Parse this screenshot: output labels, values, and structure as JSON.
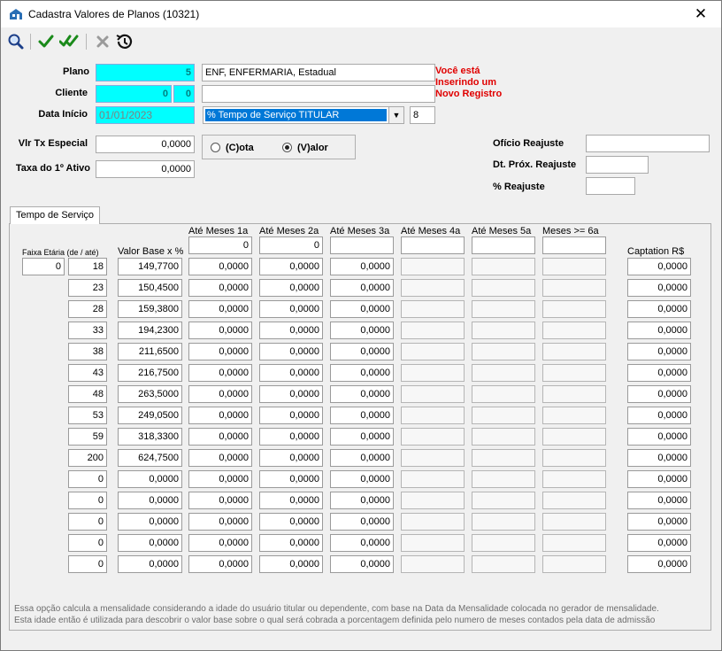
{
  "window": {
    "title": "Cadastra Valores de Planos (10321)",
    "close_glyph": "✕"
  },
  "toolbar": {
    "icons": [
      "search-icon",
      "check-icon",
      "double-check-icon",
      "cancel-x-icon",
      "history-icon"
    ],
    "accent_check": "#1a8a1a"
  },
  "form": {
    "plano": {
      "label": "Plano",
      "code": "5",
      "description": "ENF, ENFERMARIA, Estadual"
    },
    "cliente": {
      "label": "Cliente",
      "code1": "0",
      "code2": "0",
      "description": ""
    },
    "data_inicio": {
      "label": "Data Início",
      "value": "01/01/2023"
    },
    "tipo": {
      "selected": "% Tempo de Serviço TITULAR",
      "extra": "8"
    },
    "warning": {
      "line1": "Você está",
      "line2": "Inserindo um",
      "line3": "Novo Registro",
      "color": "#e00000"
    },
    "vlr_tx_especial": {
      "label": "Vlr Tx Especial",
      "value": "0,0000"
    },
    "taxa_primeiro_ativo": {
      "label": "Taxa do 1º Ativo",
      "value": "0,0000"
    },
    "radio": {
      "cota_label": "(C)ota",
      "valor_label": "(V)alor",
      "selected": "valor"
    },
    "oficio_reajuste": {
      "label": "Ofício Reajuste",
      "value": ""
    },
    "dt_prox_reajuste": {
      "label": "Dt. Próx. Reajuste",
      "value": ""
    },
    "pct_reajuste": {
      "label": "% Reajuste",
      "value": ""
    }
  },
  "tab": {
    "label": "Tempo de Serviço"
  },
  "grid": {
    "headers": {
      "faixa": "Faixa Etária (de / até)",
      "valor_base": "Valor Base x %",
      "m1": "Até Meses 1a",
      "m2": "Até Meses 2a",
      "m3": "Até Meses 3a",
      "m4": "Até Meses 4a",
      "m5": "Até Meses 5a",
      "m6": "Meses >= 6a",
      "captation": "Captation R$"
    },
    "meses_limits": [
      "0",
      "0",
      "",
      "",
      "",
      ""
    ],
    "faixa_de_first": "0",
    "rows": [
      {
        "ate": "18",
        "base": "149,7700",
        "m1": "0,0000",
        "m2": "0,0000",
        "m3": "0,0000",
        "captation": "0,0000"
      },
      {
        "ate": "23",
        "base": "150,4500",
        "m1": "0,0000",
        "m2": "0,0000",
        "m3": "0,0000",
        "captation": "0,0000"
      },
      {
        "ate": "28",
        "base": "159,3800",
        "m1": "0,0000",
        "m2": "0,0000",
        "m3": "0,0000",
        "captation": "0,0000"
      },
      {
        "ate": "33",
        "base": "194,2300",
        "m1": "0,0000",
        "m2": "0,0000",
        "m3": "0,0000",
        "captation": "0,0000"
      },
      {
        "ate": "38",
        "base": "211,6500",
        "m1": "0,0000",
        "m2": "0,0000",
        "m3": "0,0000",
        "captation": "0,0000"
      },
      {
        "ate": "43",
        "base": "216,7500",
        "m1": "0,0000",
        "m2": "0,0000",
        "m3": "0,0000",
        "captation": "0,0000"
      },
      {
        "ate": "48",
        "base": "263,5000",
        "m1": "0,0000",
        "m2": "0,0000",
        "m3": "0,0000",
        "captation": "0,0000"
      },
      {
        "ate": "53",
        "base": "249,0500",
        "m1": "0,0000",
        "m2": "0,0000",
        "m3": "0,0000",
        "captation": "0,0000"
      },
      {
        "ate": "59",
        "base": "318,3300",
        "m1": "0,0000",
        "m2": "0,0000",
        "m3": "0,0000",
        "captation": "0,0000"
      },
      {
        "ate": "200",
        "base": "624,7500",
        "m1": "0,0000",
        "m2": "0,0000",
        "m3": "0,0000",
        "captation": "0,0000"
      },
      {
        "ate": "0",
        "base": "0,0000",
        "m1": "0,0000",
        "m2": "0,0000",
        "m3": "0,0000",
        "captation": "0,0000"
      },
      {
        "ate": "0",
        "base": "0,0000",
        "m1": "0,0000",
        "m2": "0,0000",
        "m3": "0,0000",
        "captation": "0,0000"
      },
      {
        "ate": "0",
        "base": "0,0000",
        "m1": "0,0000",
        "m2": "0,0000",
        "m3": "0,0000",
        "captation": "0,0000"
      },
      {
        "ate": "0",
        "base": "0,0000",
        "m1": "0,0000",
        "m2": "0,0000",
        "m3": "0,0000",
        "captation": "0,0000"
      },
      {
        "ate": "0",
        "base": "0,0000",
        "m1": "0,0000",
        "m2": "0,0000",
        "m3": "0,0000",
        "captation": "0,0000"
      }
    ]
  },
  "footnote": {
    "line1": "Essa opção calcula a mensalidade considerando a idade do usuário titular ou dependente, com base na Data da Mensalidade colocada no gerador de mensalidade.",
    "line2": "Esta idade então é utilizada para descobrir o valor base sobre o qual será cobrada a porcentagem definida pelo numero de meses contados pela data de admissão"
  }
}
